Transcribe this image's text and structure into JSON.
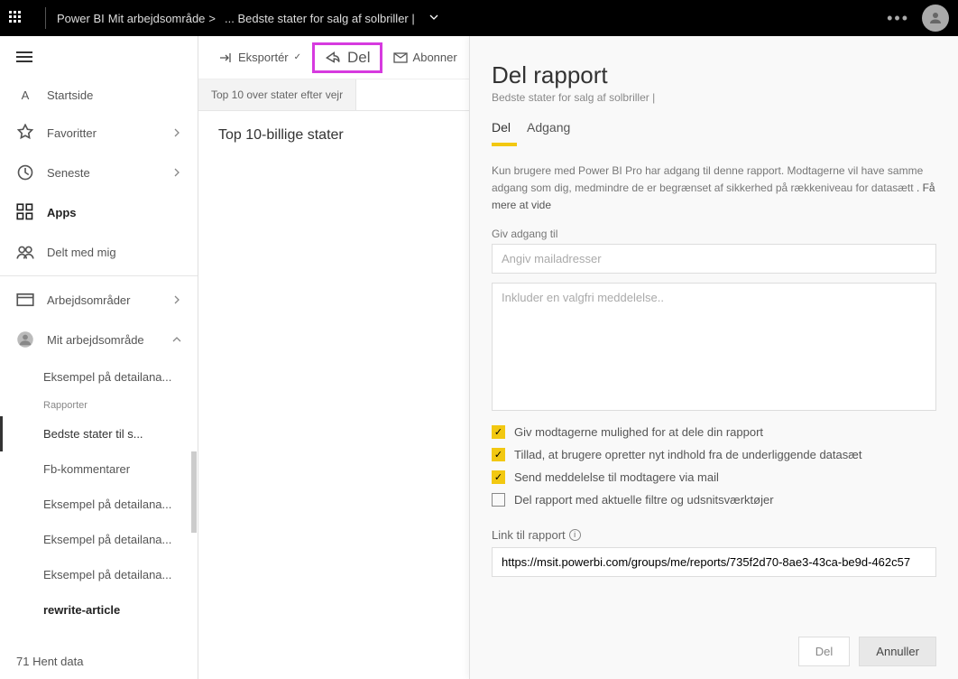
{
  "header": {
    "app": "Power BI",
    "workspace": "Mit arbejdsområde",
    "separator": ">",
    "crumb": "... Bedste stater for salg af solbriller |"
  },
  "sidebar": {
    "home": "Startside",
    "home_prefix": "A",
    "favorites": "Favoritter",
    "recent": "Seneste",
    "apps": "Apps",
    "shared": "Delt med mig",
    "workspaces": "Arbejdsområder",
    "myworkspace": "Mit arbejdsområde",
    "items": [
      "Eksempel på detailana...",
      "Rapporter",
      "Bedste stater til s...",
      "Fb-kommentarer",
      "Eksempel på detailana...",
      "Eksempel på detailana...",
      "Eksempel på detailana...",
      "rewrite-article"
    ],
    "getdata": "71 Hent data"
  },
  "toolbar": {
    "export": "Eksportér",
    "share": "Del",
    "subscribe": "Abonner"
  },
  "tabs": {
    "t1": "Top 10 over stater efter vejr"
  },
  "content": {
    "title": "Top 10-billige stater"
  },
  "panel": {
    "title": "Del rapport",
    "subtitle": "Bedste stater for salg af solbriller |",
    "tab_share": "Del",
    "tab_access": "Adgang",
    "desc1": "Kun brugere med Power BI Pro har adgang til denne rapport. Modtagerne vil have samme adgang som dig, medmindre de er begrænset af sikkerhed på rækkeniveau for datasætt",
    "desc_link": ". Få mere at vide",
    "grant_label": "Giv adgang til",
    "email_placeholder": "Angiv mailadresser",
    "message_placeholder": "Inkluder en valgfri meddelelse..",
    "check1": "Giv modtagerne mulighed for at dele din rapport",
    "check2": "Tillad, at brugere opretter nyt indhold fra de underliggende datasæt",
    "check3": "Send meddelelse til modtagere via mail",
    "check4": "Del rapport med aktuelle filtre og udsnitsværktøjer",
    "link_label": "Link til rapport",
    "url": "https://msit.powerbi.com/groups/me/reports/735f2d70-8ae3-43ca-be9d-462c57",
    "btn_share": "Del",
    "btn_cancel": "Annuller"
  }
}
